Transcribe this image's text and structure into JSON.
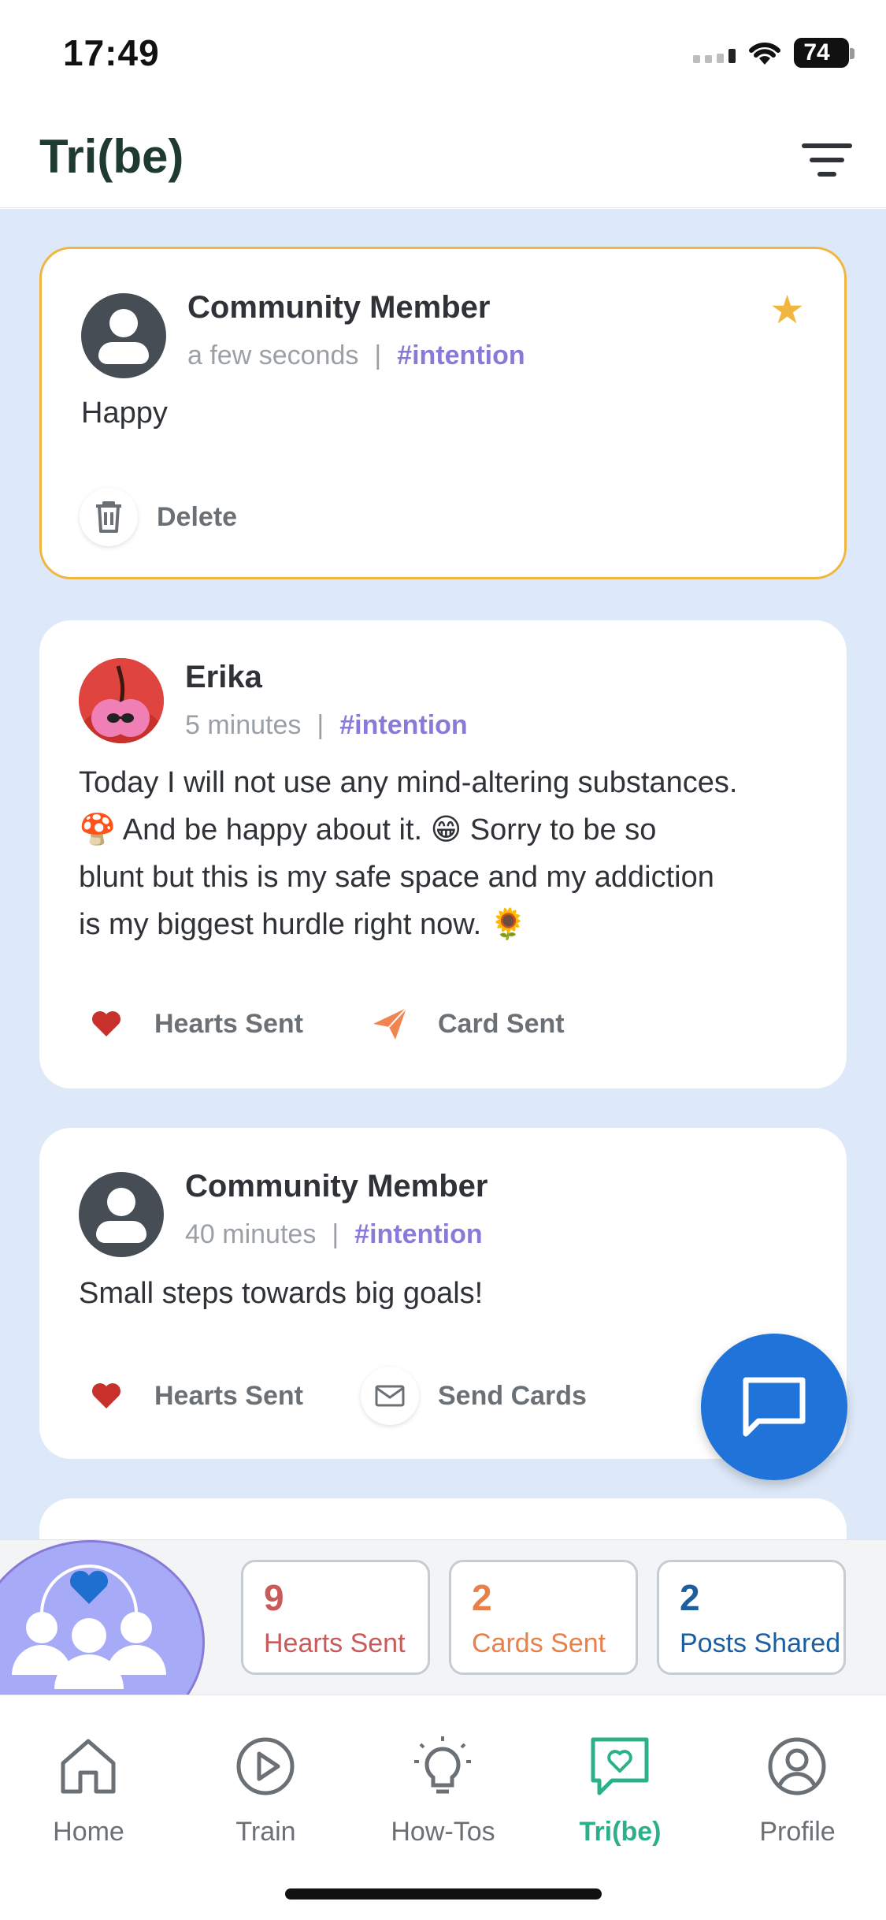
{
  "status_bar": {
    "time": "17:49",
    "battery": "74"
  },
  "header": {
    "title": "Tri(be)"
  },
  "posts": [
    {
      "author": "Community Member",
      "time": "a few seconds",
      "tag": "#intention",
      "text": "Happy",
      "action1": "Delete"
    },
    {
      "author": "Erika",
      "time": "5 minutes",
      "tag": "#intention",
      "line1": "Today I will not use any mind-altering substances.",
      "line2": "🍄 And be happy about it. 😁 Sorry to be so",
      "line3": "blunt but this is my safe space and my addiction",
      "line4": "is my biggest hurdle right now. 🌻",
      "action1": "Hearts Sent",
      "action2": "Card Sent"
    },
    {
      "author": "Community Member",
      "time": "40 minutes",
      "tag": "#intention",
      "text": "Small steps towards big goals!",
      "action1": "Hearts Sent",
      "action2": "Send Cards"
    }
  ],
  "stats": {
    "hearts": {
      "value": "9",
      "label": "Hearts Sent",
      "color": "#c85a5a"
    },
    "cards": {
      "value": "2",
      "label": "Cards Sent",
      "color": "#e8804a"
    },
    "posts": {
      "value": "2",
      "label": "Posts Shared",
      "color": "#1d5f9e"
    }
  },
  "tabs": [
    {
      "label": "Home",
      "icon": "home-icon"
    },
    {
      "label": "Train",
      "icon": "play-icon"
    },
    {
      "label": "How-Tos",
      "icon": "lightbulb-icon"
    },
    {
      "label": "Tri(be)",
      "icon": "heart-chat-icon",
      "active": true
    },
    {
      "label": "Profile",
      "icon": "profile-icon"
    }
  ],
  "colors": {
    "accent_green": "#2bb08a",
    "fab_blue": "#1f73d9",
    "feed_bg": "#dde9f9",
    "own_post_border": "#f0b63f",
    "tag_purple": "#8a7ad8"
  }
}
